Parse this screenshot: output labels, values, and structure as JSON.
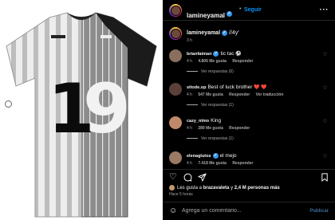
{
  "post": {
    "username": "lamineyamal",
    "follow_label": "Seguir",
    "more_icon": "more-horizontal-icon",
    "separator": "•"
  },
  "image": {
    "number_left": "1",
    "number_right": "9"
  },
  "caption": {
    "username": "lamineyamal",
    "text": "//4y'",
    "time": "3 h"
  },
  "comments": [
    {
      "username": "brianfatman",
      "text": "tic tac",
      "emoji": "⚽️",
      "time": "4 h",
      "likes": "4.806 Me gusta",
      "reply": "Responder",
      "replies": "Ver respuestas (6)"
    },
    {
      "username": "sitode.op",
      "text": "Best of luck brother",
      "emoji": "❤️ ❤️",
      "time": "4 h",
      "likes": "547 Me gusta",
      "reply": "Responder",
      "translate": "Ver traducción",
      "replies": "Ver respuestas (1)"
    },
    {
      "username": "cazy_nlmo",
      "text": "King",
      "emoji": "",
      "time": "4 h",
      "likes": "289 Me gusta",
      "reply": "Responder",
      "replies": "Ver respuestas (1)"
    },
    {
      "username": "elenaglutos",
      "text": "el mejo",
      "emoji": "",
      "time": "4 h",
      "likes": "7.418 Me gusta",
      "reply": "Responder"
    }
  ],
  "actions": {
    "like_icon": "heart-icon",
    "comment_icon": "comment-icon",
    "share_icon": "send-icon",
    "save_icon": "bookmark-icon"
  },
  "likes": {
    "prefix": "Les gusta a",
    "user": "brazavaleta",
    "connector": "y",
    "count": "2,4 M personas más"
  },
  "posted": "Hace 5 horas",
  "add_comment": {
    "placeholder": "Agrega un comentario...",
    "publish_label": "Publicar"
  },
  "colors": {
    "background": "#000000",
    "link_blue": "#0095f6",
    "verified_blue": "#3897f0",
    "muted_text": "#a8a8a8"
  }
}
